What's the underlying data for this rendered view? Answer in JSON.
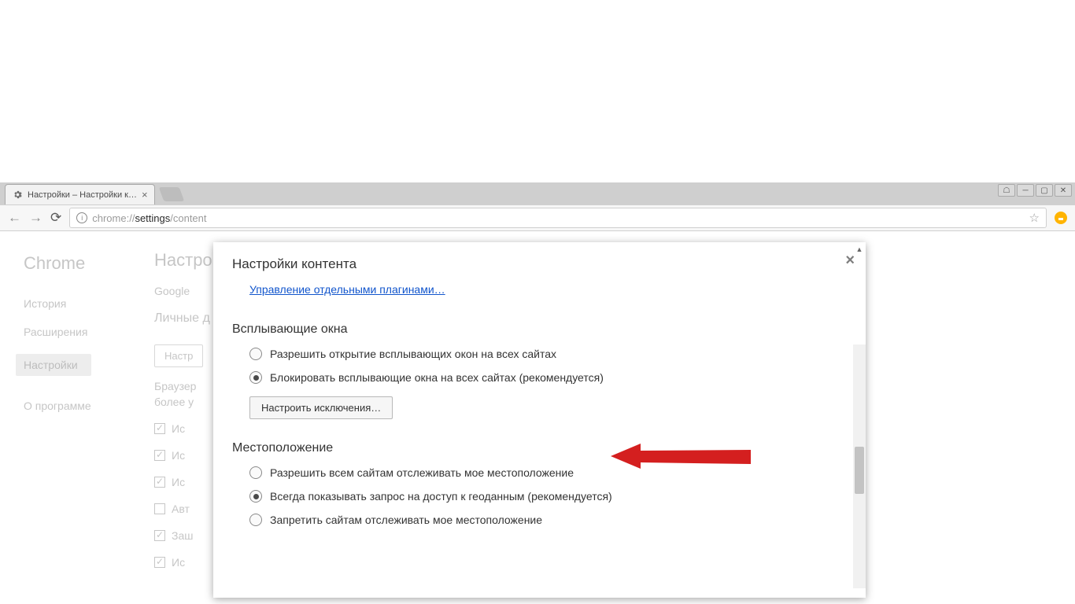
{
  "tab": {
    "title": "Настройки – Настройки к…"
  },
  "toolbar": {
    "url_pre": "chrome://",
    "url_mid": "settings",
    "url_post": "/content"
  },
  "sidebar": {
    "brand": "Chrome",
    "items": [
      "История",
      "Расширения",
      "Настройки",
      "О программе"
    ],
    "active_index": 2
  },
  "background": {
    "heading": "Настрой",
    "google_line": "Google",
    "personal_heading": "Личные д",
    "ghost_button": "Настр",
    "browser_line1": "Браузер",
    "browser_line2": "более у",
    "check_items": [
      "Ис",
      "Ис",
      "Ис",
      "Авт",
      "Заш",
      "Ис"
    ],
    "check_states": [
      true,
      true,
      true,
      false,
      true,
      true
    ]
  },
  "modal": {
    "title": "Настройки контента",
    "manage_plugins_link": "Управление отдельными плагинами…",
    "sections": [
      {
        "title": "Всплывающие окна",
        "options": [
          {
            "label": "Разрешить открытие всплывающих окон на всех сайтах",
            "selected": false
          },
          {
            "label": "Блокировать всплывающие окна на всех сайтах (рекомендуется)",
            "selected": true
          }
        ],
        "button": "Настроить исключения…"
      },
      {
        "title": "Местоположение",
        "options": [
          {
            "label": "Разрешить всем сайтам отслеживать мое местоположение",
            "selected": false
          },
          {
            "label": "Всегда показывать запрос на доступ к геоданным (рекомендуется)",
            "selected": true
          },
          {
            "label": "Запретить сайтам отслеживать мое местоположение",
            "selected": false
          }
        ]
      }
    ]
  }
}
